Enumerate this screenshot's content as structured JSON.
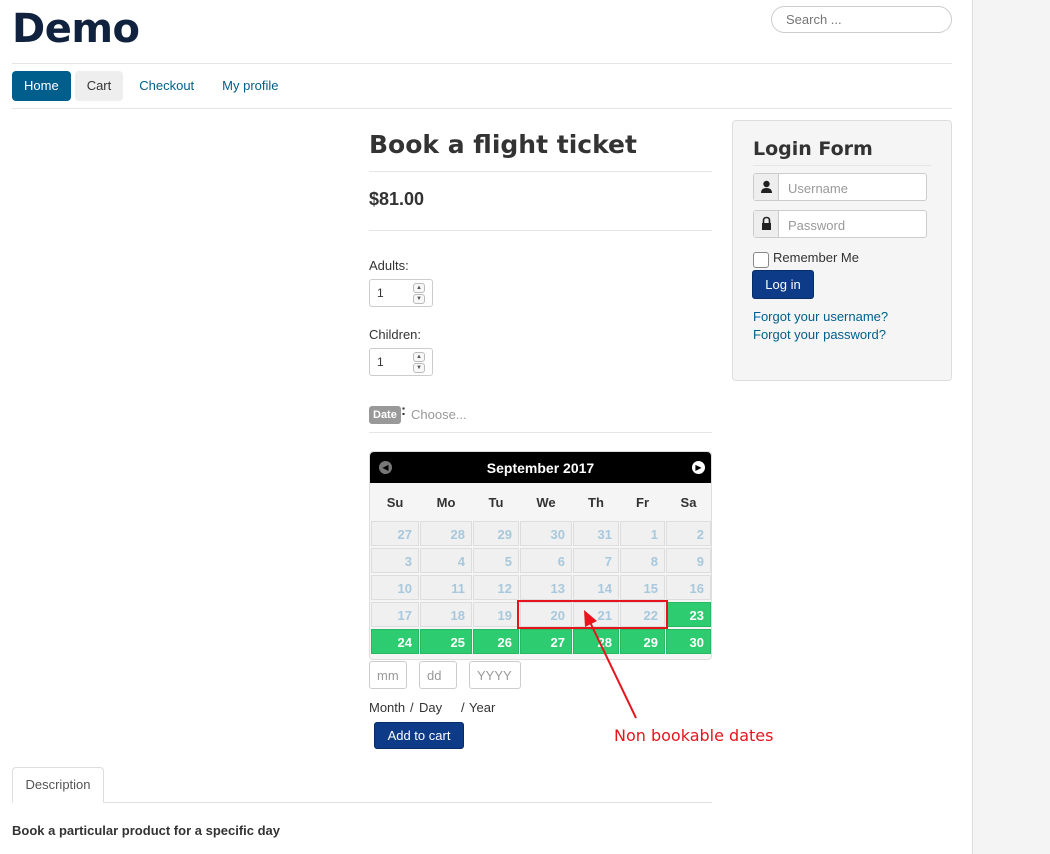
{
  "site": {
    "title": "Demo"
  },
  "search": {
    "placeholder": "Search ..."
  },
  "nav": {
    "items": [
      "Home",
      "Cart",
      "Checkout",
      "My profile"
    ]
  },
  "product": {
    "title": "Book a flight ticket",
    "price": "$81.00",
    "adults_label": "Adults:",
    "adults_value": "1",
    "children_label": "Children:",
    "children_value": "1",
    "date_badge": "Date",
    "date_colon": ":",
    "date_choose": "Choose..."
  },
  "calendar": {
    "title": "September 2017",
    "days_of_week": [
      "Su",
      "Mo",
      "Tu",
      "We",
      "Th",
      "Fr",
      "Sa"
    ],
    "weeks": [
      [
        27,
        28,
        29,
        30,
        31,
        1,
        2
      ],
      [
        3,
        4,
        5,
        6,
        7,
        8,
        9
      ],
      [
        10,
        11,
        12,
        13,
        14,
        15,
        16
      ],
      [
        17,
        18,
        19,
        20,
        21,
        22,
        23
      ],
      [
        24,
        25,
        26,
        27,
        28,
        29,
        30
      ]
    ],
    "available_days": [
      23,
      24,
      25,
      26,
      27,
      28,
      29,
      30
    ],
    "colors": {
      "header": "#000000",
      "available": "#2ecc71",
      "unavailable_text": "#a7c8dd"
    }
  },
  "date_inputs": {
    "month_placeholder": "mm",
    "day_placeholder": "dd",
    "year_placeholder": "YYYY",
    "month_label": "Month",
    "sep1": "/",
    "day_label": "Day",
    "sep2": "/",
    "year_label": "Year"
  },
  "add_to_cart": "Add to cart",
  "tabs": {
    "description": "Description"
  },
  "description_text": "Book a particular product for a specific day",
  "login": {
    "title": "Login Form",
    "username_placeholder": "Username",
    "password_placeholder": "Password",
    "remember": "Remember Me",
    "button": "Log in",
    "forgot_username": "Forgot your username?",
    "forgot_password": "Forgot your password?"
  },
  "annotation": {
    "text": "Non bookable dates",
    "color": "#e8141d"
  },
  "colors": {
    "primary": "#005e8d",
    "button": "#0d3b87"
  }
}
